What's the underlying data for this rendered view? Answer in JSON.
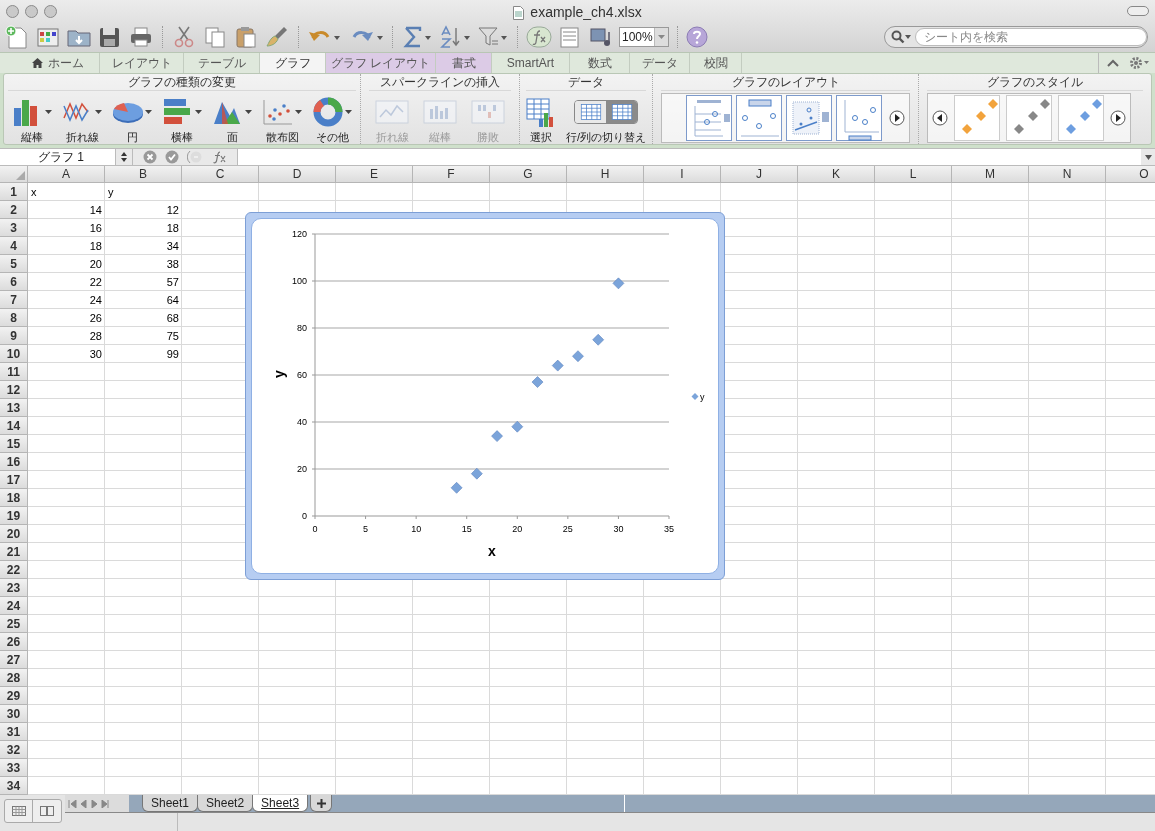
{
  "window": {
    "title": "example_ch4.xlsx"
  },
  "toolbar": {
    "zoom": "100%",
    "search": {
      "placeholder": "シート内を検索"
    }
  },
  "ribbon_tabs": [
    {
      "label": "ホーム",
      "selected": false,
      "kind": "home"
    },
    {
      "label": "レイアウト",
      "selected": false,
      "kind": "normal"
    },
    {
      "label": "テーブル",
      "selected": false,
      "kind": "normal"
    },
    {
      "label": "グラフ",
      "selected": true,
      "kind": "normal"
    },
    {
      "label": "グラフ レイアウト",
      "selected": false,
      "kind": "contextual"
    },
    {
      "label": "書式",
      "selected": false,
      "kind": "contextual"
    },
    {
      "label": "SmartArt",
      "selected": false,
      "kind": "normal"
    },
    {
      "label": "数式",
      "selected": false,
      "kind": "normal"
    },
    {
      "label": "データ",
      "selected": false,
      "kind": "normal"
    },
    {
      "label": "校閲",
      "selected": false,
      "kind": "normal"
    }
  ],
  "ribbon_groups": [
    {
      "title": "グラフの種類の変更",
      "kind": "chart-types",
      "buttons": [
        {
          "label": "縦棒",
          "dropdown": true,
          "disabled": false
        },
        {
          "label": "折れ線",
          "dropdown": true,
          "disabled": false
        },
        {
          "label": "円",
          "dropdown": true,
          "disabled": false
        },
        {
          "label": "横棒",
          "dropdown": true,
          "disabled": false
        },
        {
          "label": "面",
          "dropdown": true,
          "disabled": false
        },
        {
          "label": "散布図",
          "dropdown": true,
          "disabled": false
        },
        {
          "label": "その他",
          "dropdown": true,
          "disabled": false
        }
      ]
    },
    {
      "title": "スパークラインの挿入",
      "kind": "sparklines",
      "buttons": [
        {
          "label": "折れ線",
          "dropdown": false,
          "disabled": true
        },
        {
          "label": "縦棒",
          "dropdown": false,
          "disabled": true
        },
        {
          "label": "勝敗",
          "dropdown": false,
          "disabled": true
        }
      ]
    },
    {
      "title": "データ",
      "kind": "data",
      "buttons": [
        {
          "label": "選択",
          "disabled": false
        },
        {
          "label": "行/列の切り替え",
          "disabled": false
        }
      ]
    },
    {
      "title": "グラフのレイアウト",
      "kind": "layout-gallery"
    },
    {
      "title": "グラフのスタイル",
      "kind": "style-gallery"
    }
  ],
  "formula_bar": {
    "name_box": "グラフ 1"
  },
  "sheet": {
    "columns": [
      "A",
      "B",
      "C",
      "D",
      "E",
      "F",
      "G",
      "H",
      "I",
      "J",
      "K",
      "L",
      "M",
      "N",
      "O"
    ],
    "rows": [
      {
        "number": "1",
        "cells": [
          {
            "text": "x",
            "kind": "text"
          },
          {
            "text": "y",
            "kind": "text"
          }
        ]
      },
      {
        "number": "2",
        "cells": [
          {
            "text": "14",
            "kind": "number"
          },
          {
            "text": "12",
            "kind": "number"
          }
        ]
      },
      {
        "number": "3",
        "cells": [
          {
            "text": "16",
            "kind": "number"
          },
          {
            "text": "18",
            "kind": "number"
          }
        ]
      },
      {
        "number": "4",
        "cells": [
          {
            "text": "18",
            "kind": "number"
          },
          {
            "text": "34",
            "kind": "number"
          }
        ]
      },
      {
        "number": "5",
        "cells": [
          {
            "text": "20",
            "kind": "number"
          },
          {
            "text": "38",
            "kind": "number"
          }
        ]
      },
      {
        "number": "6",
        "cells": [
          {
            "text": "22",
            "kind": "number"
          },
          {
            "text": "57",
            "kind": "number"
          }
        ]
      },
      {
        "number": "7",
        "cells": [
          {
            "text": "24",
            "kind": "number"
          },
          {
            "text": "64",
            "kind": "number"
          }
        ]
      },
      {
        "number": "8",
        "cells": [
          {
            "text": "26",
            "kind": "number"
          },
          {
            "text": "68",
            "kind": "number"
          }
        ]
      },
      {
        "number": "9",
        "cells": [
          {
            "text": "28",
            "kind": "number"
          },
          {
            "text": "75",
            "kind": "number"
          }
        ]
      },
      {
        "number": "10",
        "cells": [
          {
            "text": "30",
            "kind": "number"
          },
          {
            "text": "99",
            "kind": "number"
          }
        ]
      },
      {
        "number": "11"
      },
      {
        "number": "12"
      },
      {
        "number": "13"
      },
      {
        "number": "14"
      },
      {
        "number": "15"
      },
      {
        "number": "16"
      },
      {
        "number": "17"
      },
      {
        "number": "18"
      },
      {
        "number": "19"
      },
      {
        "number": "20"
      },
      {
        "number": "21"
      },
      {
        "number": "22"
      },
      {
        "number": "23"
      },
      {
        "number": "24"
      },
      {
        "number": "25"
      },
      {
        "number": "26"
      },
      {
        "number": "27"
      },
      {
        "number": "28"
      },
      {
        "number": "29"
      },
      {
        "number": "30"
      },
      {
        "number": "31"
      },
      {
        "number": "32"
      },
      {
        "number": "33"
      },
      {
        "number": "34"
      }
    ]
  },
  "chart": {
    "chart_data": {
      "type": "scatter",
      "xlabel": "x",
      "ylabel": "y",
      "x": [
        14,
        16,
        18,
        20,
        22,
        24,
        26,
        28,
        30
      ],
      "series": [
        {
          "name": "y",
          "color": "#7ba4da",
          "values": [
            12,
            18,
            34,
            38,
            57,
            64,
            68,
            75,
            99
          ]
        }
      ],
      "xlim": [
        0,
        35
      ],
      "ylim": [
        0,
        120
      ],
      "xticks": [
        0,
        5,
        10,
        15,
        20,
        25,
        30,
        35
      ],
      "yticks": [
        0,
        20,
        40,
        60,
        80,
        100,
        120
      ],
      "grid": true
    }
  },
  "sheet_tabs": [
    {
      "label": "Sheet1",
      "selected": false
    },
    {
      "label": "Sheet2",
      "selected": false
    },
    {
      "label": "Sheet3",
      "selected": true
    }
  ]
}
